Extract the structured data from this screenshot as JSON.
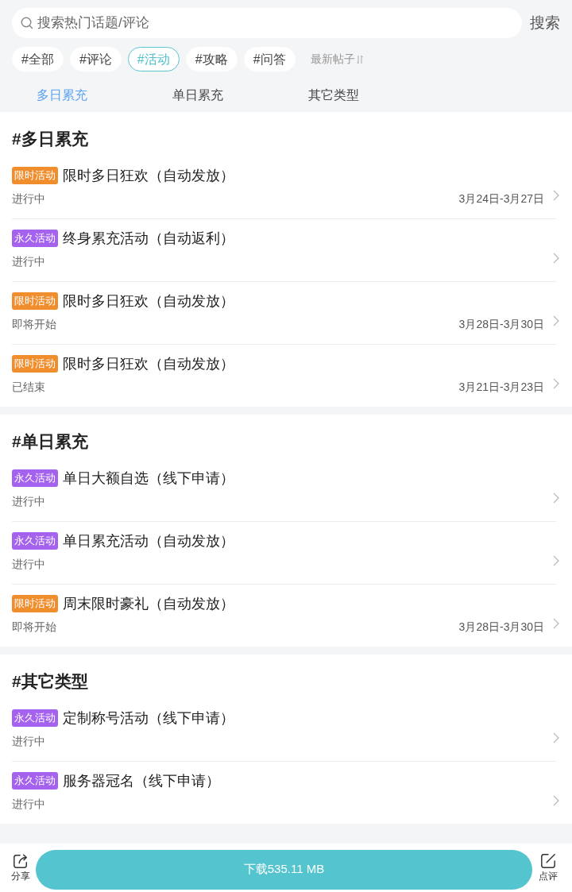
{
  "search": {
    "placeholder": "搜索热门话题/评论",
    "button": "搜索"
  },
  "filters": [
    {
      "label": "#全部",
      "selected": false
    },
    {
      "label": "#评论",
      "selected": false
    },
    {
      "label": "#活动",
      "selected": true
    },
    {
      "label": "#攻略",
      "selected": false
    },
    {
      "label": "#问答",
      "selected": false
    }
  ],
  "sort": {
    "label": "最新帖子"
  },
  "tabs": [
    {
      "label": "多日累充",
      "selected": true
    },
    {
      "label": "单日累充",
      "selected": false
    },
    {
      "label": "其它类型",
      "selected": false
    }
  ],
  "sections": [
    {
      "title": "#多日累充",
      "items": [
        {
          "tag": {
            "label": "限时活动",
            "color": "#f08d2d"
          },
          "title": "限时多日狂欢（自动发放）",
          "status": "进行中",
          "dates": "3月24日-3月27日"
        },
        {
          "tag": {
            "label": "永久活动",
            "color": "#a462ee"
          },
          "title": "终身累充活动（自动返利）",
          "status": "进行中"
        },
        {
          "tag": {
            "label": "限时活动",
            "color": "#f08d2d"
          },
          "title": "限时多日狂欢（自动发放）",
          "status": "即将开始",
          "dates": "3月28日-3月30日"
        },
        {
          "tag": {
            "label": "限时活动",
            "color": "#f08d2d"
          },
          "title": "限时多日狂欢（自动发放）",
          "status": "已结束",
          "dates": "3月21日-3月23日"
        }
      ]
    },
    {
      "title": "#单日累充",
      "items": [
        {
          "tag": {
            "label": "永久活动",
            "color": "#a462ee"
          },
          "title": "单日大额自选（线下申请）",
          "status": "进行中"
        },
        {
          "tag": {
            "label": "永久活动",
            "color": "#a462ee"
          },
          "title": "单日累充活动（自动发放）",
          "status": "进行中"
        },
        {
          "tag": {
            "label": "限时活动",
            "color": "#f08d2d"
          },
          "title": "周末限时豪礼（自动发放）",
          "status": "即将开始",
          "dates": "3月28日-3月30日"
        }
      ]
    },
    {
      "title": "#其它类型",
      "items": [
        {
          "tag": {
            "label": "永久活动",
            "color": "#a462ee"
          },
          "title": "定制称号活动（线下申请）",
          "status": "进行中"
        },
        {
          "tag": {
            "label": "永久活动",
            "color": "#a462ee"
          },
          "title": "服务器冠名（线下申请）",
          "status": "进行中"
        }
      ]
    }
  ],
  "bottom_bar": {
    "share": "分享",
    "download": "下载535.11 MB",
    "review": "点评"
  }
}
